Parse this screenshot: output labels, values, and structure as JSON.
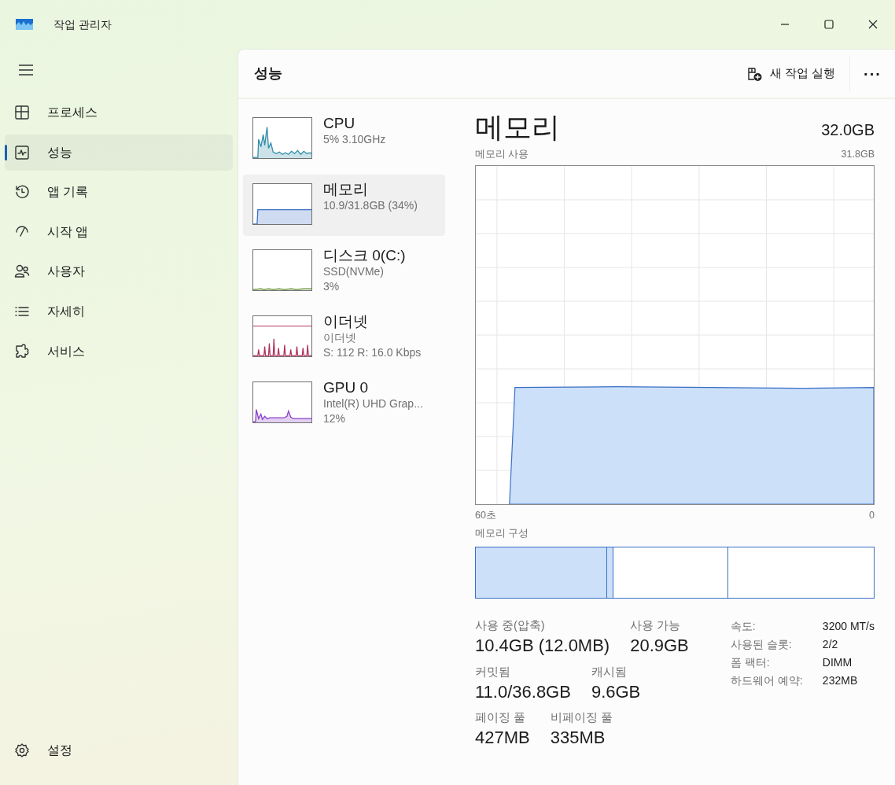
{
  "window": {
    "title": "작업 관리자"
  },
  "sidebar": {
    "items": [
      {
        "kind": "processes",
        "label": "프로세스",
        "selected": false
      },
      {
        "kind": "performance",
        "label": "성능",
        "selected": true
      },
      {
        "kind": "history",
        "label": "앱 기록",
        "selected": false
      },
      {
        "kind": "startup",
        "label": "시작 앱",
        "selected": false
      },
      {
        "kind": "users",
        "label": "사용자",
        "selected": false
      },
      {
        "kind": "details",
        "label": "자세히",
        "selected": false
      },
      {
        "kind": "services",
        "label": "서비스",
        "selected": false
      }
    ],
    "settings": "설정"
  },
  "header": {
    "title": "성능",
    "run_task": "새 작업 실행",
    "more": "···"
  },
  "devices": [
    {
      "kind": "cpu",
      "color": "#2f8ca8",
      "name": "CPU",
      "lines": [
        "5% 3.10GHz"
      ],
      "selected": false
    },
    {
      "kind": "memory",
      "color": "#3a6fc4",
      "name": "메모리",
      "lines": [
        "10.9/31.8GB (34%)"
      ],
      "selected": true
    },
    {
      "kind": "disk",
      "color": "#5a8a2a",
      "name": "디스크 0(C:)",
      "lines": [
        "SSD(NVMe)",
        "3%"
      ],
      "selected": false
    },
    {
      "kind": "ethernet",
      "color": "#b0325a",
      "name": "이더넷",
      "lines": [
        "이더넷",
        "S: 112 R: 16.0 Kbps"
      ],
      "selected": false
    },
    {
      "kind": "gpu",
      "color": "#8a3fc8",
      "name": "GPU 0",
      "lines": [
        "Intel(R) UHD Grap...",
        "12%"
      ],
      "selected": false
    }
  ],
  "detail": {
    "title": "메모리",
    "total": "32.0GB",
    "usage_graph": {
      "label": "메모리 사용",
      "max": "31.8GB",
      "x_start": "60초",
      "x_end": "0"
    },
    "composition": {
      "label": "메모리 구성"
    },
    "stats": [
      [
        {
          "label": "사용 중(압축)",
          "value": "10.4GB (12.0MB)"
        },
        {
          "label": "사용 가능",
          "value": "20.9GB"
        }
      ],
      [
        {
          "label": "커밋됨",
          "value": "11.0/36.8GB"
        },
        {
          "label": "캐시됨",
          "value": "9.6GB"
        }
      ],
      [
        {
          "label": "페이징 풀",
          "value": "427MB"
        },
        {
          "label": "비페이징 풀",
          "value": "335MB"
        }
      ]
    ],
    "specs": [
      {
        "label": "속도:",
        "value": "3200 MT/s"
      },
      {
        "label": "사용된 슬롯:",
        "value": "2/2"
      },
      {
        "label": "폼 팩터:",
        "value": "DIMM"
      },
      {
        "label": "하드웨어 예약:",
        "value": "232MB"
      }
    ]
  }
}
